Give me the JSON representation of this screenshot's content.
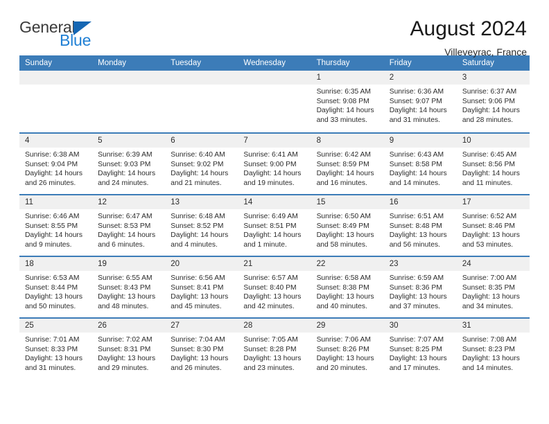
{
  "brand": {
    "name_part1": "General",
    "name_part2": "Blue",
    "logo_icon": "triangle-icon"
  },
  "header": {
    "title": "August 2024",
    "subtitle": "Villeveyrac, France"
  },
  "calendar": {
    "weekday_headers": [
      "Sunday",
      "Monday",
      "Tuesday",
      "Wednesday",
      "Thursday",
      "Friday",
      "Saturday"
    ],
    "colors": {
      "header_blue": "#3c7cb8",
      "day_number_background": "#f0f0f0",
      "brand_blue": "#1f7fd4",
      "text": "#2b2b2b"
    },
    "labels": {
      "sunrise_prefix": "Sunrise:",
      "sunset_prefix": "Sunset:",
      "daylight_prefix": "Daylight:"
    },
    "weeks": [
      [
        {
          "day": "",
          "empty": true
        },
        {
          "day": "",
          "empty": true
        },
        {
          "day": "",
          "empty": true
        },
        {
          "day": "",
          "empty": true
        },
        {
          "day": "1",
          "sunrise": "Sunrise: 6:35 AM",
          "sunset": "Sunset: 9:08 PM",
          "daylight": "Daylight: 14 hours and 33 minutes."
        },
        {
          "day": "2",
          "sunrise": "Sunrise: 6:36 AM",
          "sunset": "Sunset: 9:07 PM",
          "daylight": "Daylight: 14 hours and 31 minutes."
        },
        {
          "day": "3",
          "sunrise": "Sunrise: 6:37 AM",
          "sunset": "Sunset: 9:06 PM",
          "daylight": "Daylight: 14 hours and 28 minutes."
        }
      ],
      [
        {
          "day": "4",
          "sunrise": "Sunrise: 6:38 AM",
          "sunset": "Sunset: 9:04 PM",
          "daylight": "Daylight: 14 hours and 26 minutes."
        },
        {
          "day": "5",
          "sunrise": "Sunrise: 6:39 AM",
          "sunset": "Sunset: 9:03 PM",
          "daylight": "Daylight: 14 hours and 24 minutes."
        },
        {
          "day": "6",
          "sunrise": "Sunrise: 6:40 AM",
          "sunset": "Sunset: 9:02 PM",
          "daylight": "Daylight: 14 hours and 21 minutes."
        },
        {
          "day": "7",
          "sunrise": "Sunrise: 6:41 AM",
          "sunset": "Sunset: 9:00 PM",
          "daylight": "Daylight: 14 hours and 19 minutes."
        },
        {
          "day": "8",
          "sunrise": "Sunrise: 6:42 AM",
          "sunset": "Sunset: 8:59 PM",
          "daylight": "Daylight: 14 hours and 16 minutes."
        },
        {
          "day": "9",
          "sunrise": "Sunrise: 6:43 AM",
          "sunset": "Sunset: 8:58 PM",
          "daylight": "Daylight: 14 hours and 14 minutes."
        },
        {
          "day": "10",
          "sunrise": "Sunrise: 6:45 AM",
          "sunset": "Sunset: 8:56 PM",
          "daylight": "Daylight: 14 hours and 11 minutes."
        }
      ],
      [
        {
          "day": "11",
          "sunrise": "Sunrise: 6:46 AM",
          "sunset": "Sunset: 8:55 PM",
          "daylight": "Daylight: 14 hours and 9 minutes."
        },
        {
          "day": "12",
          "sunrise": "Sunrise: 6:47 AM",
          "sunset": "Sunset: 8:53 PM",
          "daylight": "Daylight: 14 hours and 6 minutes."
        },
        {
          "day": "13",
          "sunrise": "Sunrise: 6:48 AM",
          "sunset": "Sunset: 8:52 PM",
          "daylight": "Daylight: 14 hours and 4 minutes."
        },
        {
          "day": "14",
          "sunrise": "Sunrise: 6:49 AM",
          "sunset": "Sunset: 8:51 PM",
          "daylight": "Daylight: 14 hours and 1 minute."
        },
        {
          "day": "15",
          "sunrise": "Sunrise: 6:50 AM",
          "sunset": "Sunset: 8:49 PM",
          "daylight": "Daylight: 13 hours and 58 minutes."
        },
        {
          "day": "16",
          "sunrise": "Sunrise: 6:51 AM",
          "sunset": "Sunset: 8:48 PM",
          "daylight": "Daylight: 13 hours and 56 minutes."
        },
        {
          "day": "17",
          "sunrise": "Sunrise: 6:52 AM",
          "sunset": "Sunset: 8:46 PM",
          "daylight": "Daylight: 13 hours and 53 minutes."
        }
      ],
      [
        {
          "day": "18",
          "sunrise": "Sunrise: 6:53 AM",
          "sunset": "Sunset: 8:44 PM",
          "daylight": "Daylight: 13 hours and 50 minutes."
        },
        {
          "day": "19",
          "sunrise": "Sunrise: 6:55 AM",
          "sunset": "Sunset: 8:43 PM",
          "daylight": "Daylight: 13 hours and 48 minutes."
        },
        {
          "day": "20",
          "sunrise": "Sunrise: 6:56 AM",
          "sunset": "Sunset: 8:41 PM",
          "daylight": "Daylight: 13 hours and 45 minutes."
        },
        {
          "day": "21",
          "sunrise": "Sunrise: 6:57 AM",
          "sunset": "Sunset: 8:40 PM",
          "daylight": "Daylight: 13 hours and 42 minutes."
        },
        {
          "day": "22",
          "sunrise": "Sunrise: 6:58 AM",
          "sunset": "Sunset: 8:38 PM",
          "daylight": "Daylight: 13 hours and 40 minutes."
        },
        {
          "day": "23",
          "sunrise": "Sunrise: 6:59 AM",
          "sunset": "Sunset: 8:36 PM",
          "daylight": "Daylight: 13 hours and 37 minutes."
        },
        {
          "day": "24",
          "sunrise": "Sunrise: 7:00 AM",
          "sunset": "Sunset: 8:35 PM",
          "daylight": "Daylight: 13 hours and 34 minutes."
        }
      ],
      [
        {
          "day": "25",
          "sunrise": "Sunrise: 7:01 AM",
          "sunset": "Sunset: 8:33 PM",
          "daylight": "Daylight: 13 hours and 31 minutes."
        },
        {
          "day": "26",
          "sunrise": "Sunrise: 7:02 AM",
          "sunset": "Sunset: 8:31 PM",
          "daylight": "Daylight: 13 hours and 29 minutes."
        },
        {
          "day": "27",
          "sunrise": "Sunrise: 7:04 AM",
          "sunset": "Sunset: 8:30 PM",
          "daylight": "Daylight: 13 hours and 26 minutes."
        },
        {
          "day": "28",
          "sunrise": "Sunrise: 7:05 AM",
          "sunset": "Sunset: 8:28 PM",
          "daylight": "Daylight: 13 hours and 23 minutes."
        },
        {
          "day": "29",
          "sunrise": "Sunrise: 7:06 AM",
          "sunset": "Sunset: 8:26 PM",
          "daylight": "Daylight: 13 hours and 20 minutes."
        },
        {
          "day": "30",
          "sunrise": "Sunrise: 7:07 AM",
          "sunset": "Sunset: 8:25 PM",
          "daylight": "Daylight: 13 hours and 17 minutes."
        },
        {
          "day": "31",
          "sunrise": "Sunrise: 7:08 AM",
          "sunset": "Sunset: 8:23 PM",
          "daylight": "Daylight: 13 hours and 14 minutes."
        }
      ]
    ]
  }
}
